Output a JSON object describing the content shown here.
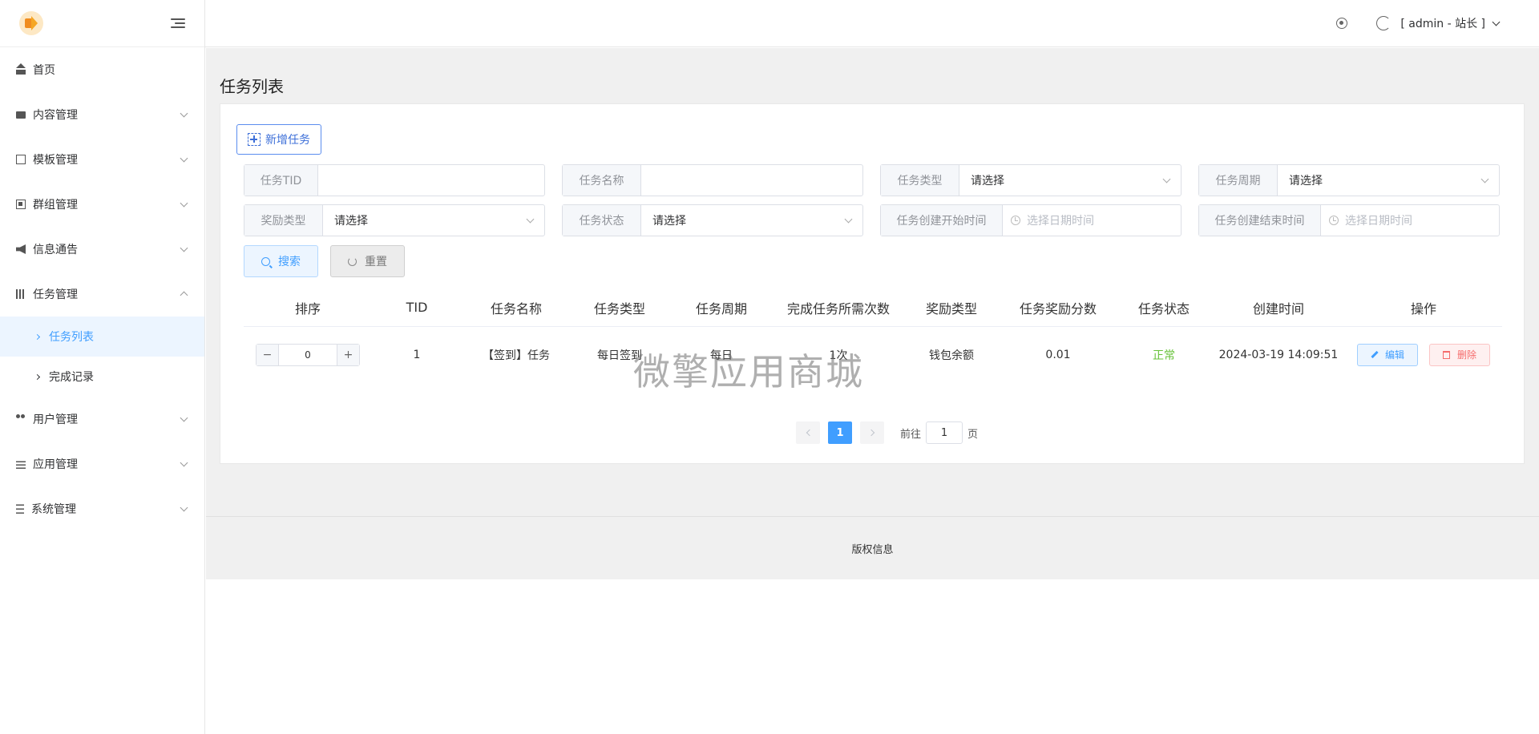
{
  "sidebar": {
    "items": [
      {
        "label": "首页",
        "icon": "home-icon"
      },
      {
        "label": "内容管理",
        "icon": "chat-icon"
      },
      {
        "label": "模板管理",
        "icon": "template-icon"
      },
      {
        "label": "群组管理",
        "icon": "group-icon"
      },
      {
        "label": "信息通告",
        "icon": "speaker-icon"
      },
      {
        "label": "任务管理",
        "icon": "task-icon"
      },
      {
        "label": "用户管理",
        "icon": "users-icon"
      },
      {
        "label": "应用管理",
        "icon": "app-icon"
      },
      {
        "label": "系统管理",
        "icon": "system-icon"
      }
    ],
    "sub_items": [
      {
        "label": "任务列表",
        "active": true
      },
      {
        "label": "完成记录",
        "active": false
      }
    ]
  },
  "header": {
    "user_label": "[ admin - 站长 ]"
  },
  "page": {
    "title": "任务列表",
    "add_button": "新增任务"
  },
  "filters": {
    "tid_label": "任务TID",
    "name_label": "任务名称",
    "type_label": "任务类型",
    "period_label": "任务周期",
    "reward_type_label": "奖励类型",
    "status_label": "任务状态",
    "start_label": "任务创建开始时间",
    "end_label": "任务创建结束时间",
    "select_placeholder": "请选择",
    "date_placeholder": "选择日期时间",
    "search_button": "搜索",
    "reset_button": "重置"
  },
  "table": {
    "headers": [
      "排序",
      "TID",
      "任务名称",
      "任务类型",
      "任务周期",
      "完成任务所需次数",
      "奖励类型",
      "任务奖励分数",
      "任务状态",
      "创建时间",
      "操作"
    ],
    "rows": [
      {
        "sort": "0",
        "tid": "1",
        "name": "【签到】任务",
        "type": "每日签到",
        "period": "每日",
        "times": "1次",
        "reward_type": "钱包余额",
        "score": "0.01",
        "status": "正常",
        "created": "2024-03-19 14:09:51",
        "edit": "编辑",
        "delete": "删除"
      }
    ],
    "stepper_minus": "−",
    "stepper_plus": "+"
  },
  "pagination": {
    "current": "1",
    "goto_prefix": "前往",
    "goto_value": "1",
    "goto_suffix": "页"
  },
  "footer": {
    "text": "版权信息"
  },
  "watermark": "微擎应用商城",
  "colors": {
    "primary": "#409eff",
    "success": "#67c23a",
    "danger": "#f56c6c"
  }
}
